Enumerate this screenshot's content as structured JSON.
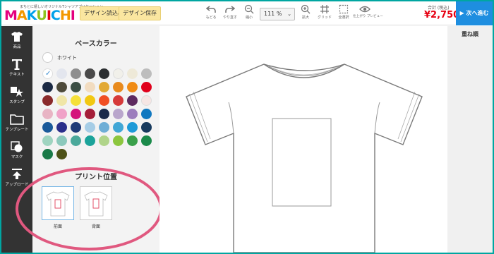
{
  "header": {
    "logo_tagline": "まちとに嬉しいオリジナルTシャツアプリケーション",
    "logo_letters": [
      {
        "ch": "M",
        "color": "#e4007f"
      },
      {
        "ch": "A",
        "color": "#f39800"
      },
      {
        "ch": "K",
        "color": "#00a0e9"
      },
      {
        "ch": "U",
        "color": "#8fc31f"
      },
      {
        "ch": "I",
        "color": "#e60012"
      },
      {
        "ch": "C",
        "color": "#00a0e9"
      },
      {
        "ch": "H",
        "color": "#f39800"
      },
      {
        "ch": "I",
        "color": "#e4007f"
      }
    ],
    "load_design": "デザイン読込み",
    "save_design": "デザイン保存",
    "tools": {
      "undo": "もどる",
      "redo": "やり直す",
      "zoom_out": "縮小",
      "zoom_in": "拡大",
      "grid": "グリッド",
      "select_all": "全選択",
      "preview": "仕上がり プレビュー"
    },
    "zoom_value": "111 %",
    "total_label": "合計 (税込)",
    "total_price": "¥2,750",
    "next_button": "▶ 次へ進む"
  },
  "nav": [
    {
      "label": "商品",
      "icon": "tshirt-icon"
    },
    {
      "label": "テキスト",
      "icon": "text-icon"
    },
    {
      "label": "スタンプ",
      "icon": "stamp-icon"
    },
    {
      "label": "テンプレート",
      "icon": "folder-icon"
    },
    {
      "label": "マスク",
      "icon": "mask-icon"
    },
    {
      "label": "アップロード",
      "icon": "upload-icon"
    }
  ],
  "panel": {
    "title": "ベースカラー",
    "white_label": "ホワイト",
    "colors": [
      "#ffffff",
      "#e3e6ee",
      "#8e8e8e",
      "#4a4a4a",
      "#2c2f31",
      "#f1f0ea",
      "#eee9d8",
      "#bdbdbd",
      "#1b2a44",
      "#4d4a3a",
      "#3c4f45",
      "#f2dcc0",
      "#e2a935",
      "#e88a1d",
      "#f08b14",
      "#e0001b",
      "#8a2a2b",
      "#f0e6a8",
      "#f5e03a",
      "#f2c812",
      "#f04e23",
      "#d63a3a",
      "#5d2a5f",
      "#f6e6e4",
      "#e8b4c4",
      "#f0a2c8",
      "#d4127c",
      "#a51f3a",
      "#1a2a4a",
      "#b9a6cc",
      "#9c7dbd",
      "#1078c0",
      "#1a5a9a",
      "#2a2f8a",
      "#1e3a78",
      "#a6cde6",
      "#6eaed6",
      "#41a7d6",
      "#1d9ad8",
      "#173a5e",
      "#9fd4c0",
      "#8cc9bc",
      "#4aa89a",
      "#1ba39a",
      "#b0d48a",
      "#8cc63e",
      "#3aa04a",
      "#1b8a4a",
      "#1a7a48",
      "#4e5218"
    ],
    "selected_index": 0,
    "print_title": "プリント位置",
    "print_front": "前面",
    "print_back": "背面"
  },
  "right_panel": {
    "title": "重ね順"
  }
}
